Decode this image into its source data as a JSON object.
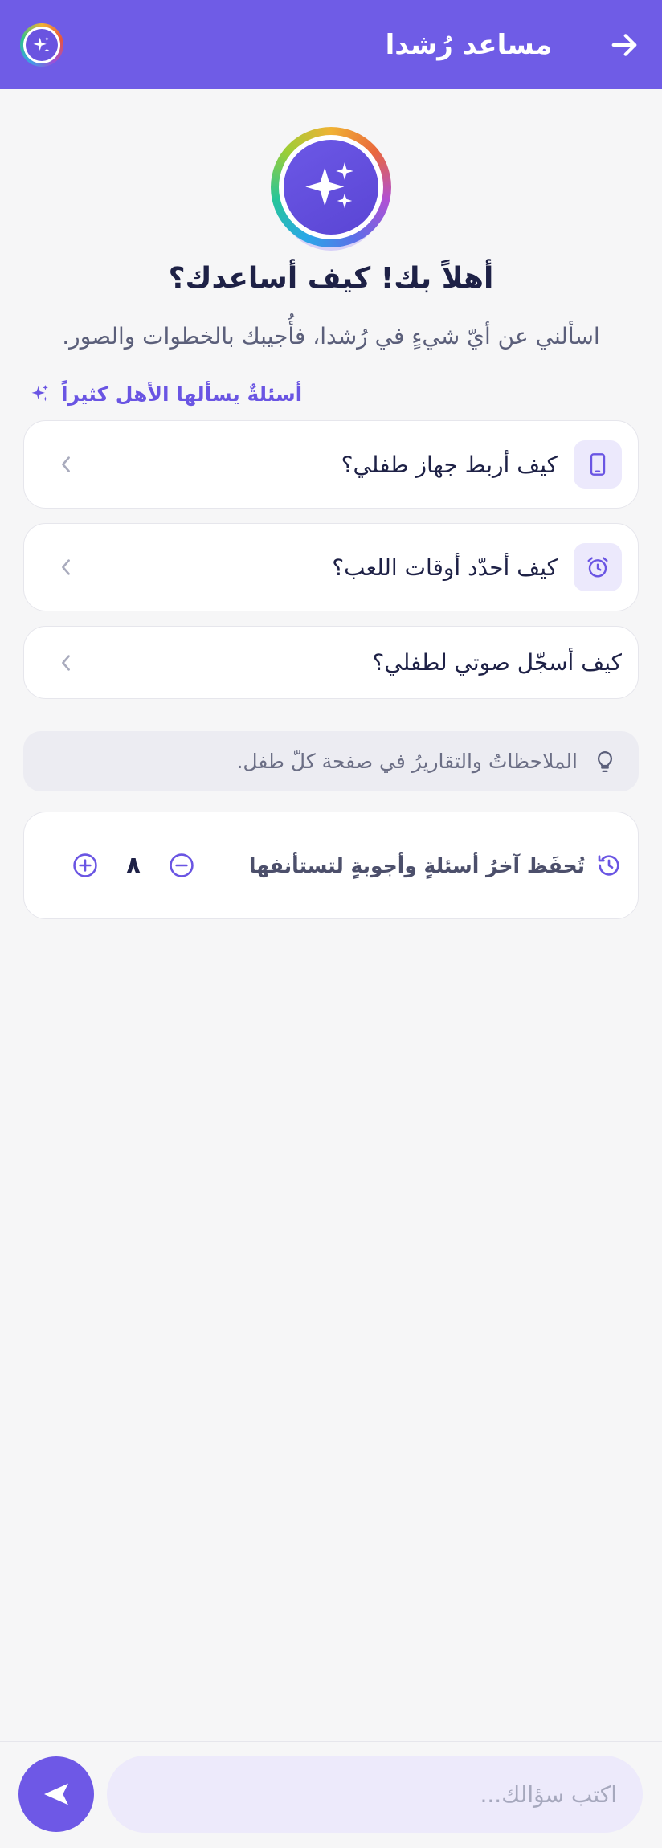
{
  "header": {
    "title": "مساعد رُشدا",
    "back_icon": "arrow-right-icon",
    "avatar_icon": "sparkles-icon",
    "background": "#6f5ce6"
  },
  "hero": {
    "icon": "sparkles-icon",
    "title": "أهلاً بك! كيف أساعدك؟",
    "subtitle": "اسألني عن أيّ شيءٍ في رُشدا، فأُجيبك بالخطوات والصور."
  },
  "faq": {
    "heading": "أسئلةٌ يسألها الأهل كثيراً",
    "heading_icon": "sparkles-icon",
    "items": [
      {
        "label": "كيف أربط جهاز طفلي؟",
        "icon": "tablet-icon"
      },
      {
        "label": "كيف أحدّد أوقات اللعب؟",
        "icon": "alarm-clock-icon"
      },
      {
        "label": "كيف أسجّل صوتي لطفلي؟",
        "icon": ""
      }
    ]
  },
  "tip": {
    "icon": "lightbulb-icon",
    "text": "الملاحظاتُ والتقاريرُ في صفحة كلّ طفل."
  },
  "history": {
    "icon": "history-icon",
    "text": "تُحفَظ آخرُ أسئلةٍ وأجوبةٍ لتستأنفها",
    "count": "٨"
  },
  "composer": {
    "placeholder": "اكتب سؤالك...",
    "send_icon": "send-icon"
  },
  "colors": {
    "accent": "#6e58e6",
    "accent_light": "#ece9fc"
  }
}
